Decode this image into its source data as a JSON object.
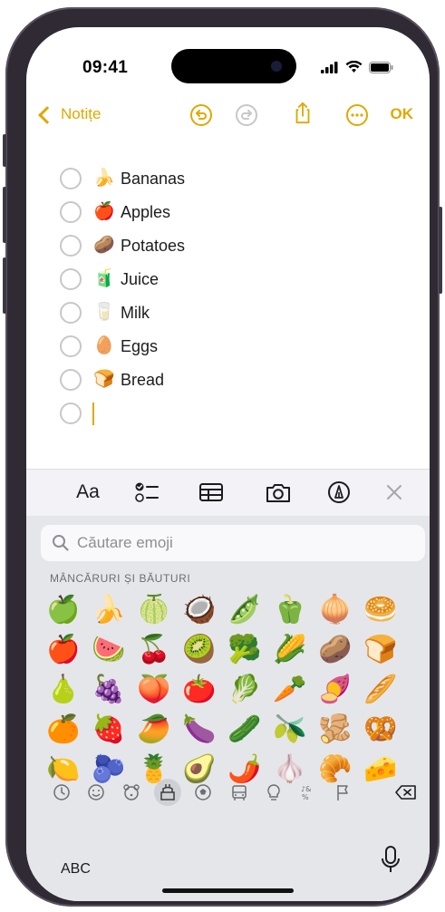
{
  "status_bar": {
    "time": "09:41"
  },
  "nav": {
    "back_label": "Notițe",
    "done_label": "OK"
  },
  "checklist": [
    {
      "emoji": "🍌",
      "label": "Bananas"
    },
    {
      "emoji": "🍎",
      "label": "Apples"
    },
    {
      "emoji": "🥔",
      "label": "Potatoes"
    },
    {
      "emoji": "🧃",
      "label": "Juice"
    },
    {
      "emoji": "🥛",
      "label": "Milk"
    },
    {
      "emoji": "🥚",
      "label": "Eggs"
    },
    {
      "emoji": "🍞",
      "label": "Bread"
    }
  ],
  "toolbar": {
    "format_label": "Aa"
  },
  "keyboard": {
    "search_placeholder": "Căutare emoji",
    "category_title": "MÂNCĂRURI ȘI BĂUTURI",
    "abc_label": "ABC",
    "emoji_rows": [
      [
        "🍏",
        "🍌",
        "🍈",
        "🥥",
        "🫛",
        "🫑",
        "🧅",
        "🥯"
      ],
      [
        "🍎",
        "🍉",
        "🍒",
        "🥝",
        "🥦",
        "🌽",
        "🥔",
        "🍞"
      ],
      [
        "🍐",
        "🍇",
        "🍑",
        "🍅",
        "🥬",
        "🥕",
        "🍠",
        "🥖"
      ],
      [
        "🍊",
        "🍓",
        "🥭",
        "🍆",
        "🥒",
        "🫒",
        "🫚",
        "🥨"
      ],
      [
        "🍋",
        "🫐",
        "🍍",
        "🥑",
        "🌶️",
        "🧄",
        "🥐",
        "🧀"
      ]
    ],
    "categories": [
      "recent",
      "smileys",
      "animals",
      "food",
      "activity",
      "travel",
      "objects",
      "symbols",
      "flags"
    ],
    "active_category": "food"
  },
  "colors": {
    "accent": "#e0a800",
    "keyboard_bg": "#e5e6ea",
    "toolbar_bg": "#f2f2f7"
  }
}
